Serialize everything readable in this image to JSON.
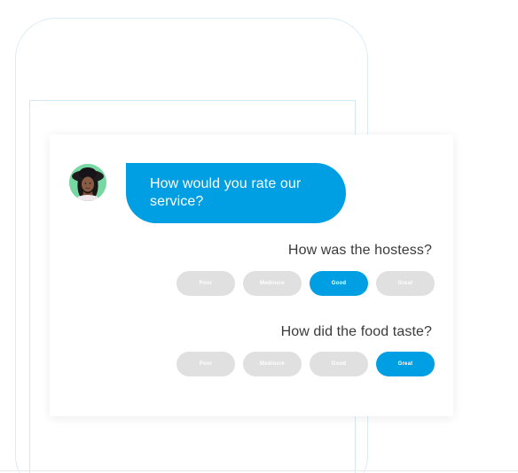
{
  "chat": {
    "bot_message": "How would you rate our service?"
  },
  "questions": [
    {
      "text": "How was the hostess?",
      "options": [
        "Poor",
        "Mediocre",
        "Good",
        "Great"
      ],
      "selected": "Good"
    },
    {
      "text": "How did the food taste?",
      "options": [
        "Poor",
        "Mediocre",
        "Good",
        "Great"
      ],
      "selected": "Great"
    }
  ],
  "colors": {
    "accent": "#009fe3",
    "unselected": "#e0e0e0",
    "frame": "#d9ecf8",
    "question_text": "#3a3a3a"
  },
  "icons": {
    "avatar": "woman-with-black-hat-avatar"
  }
}
